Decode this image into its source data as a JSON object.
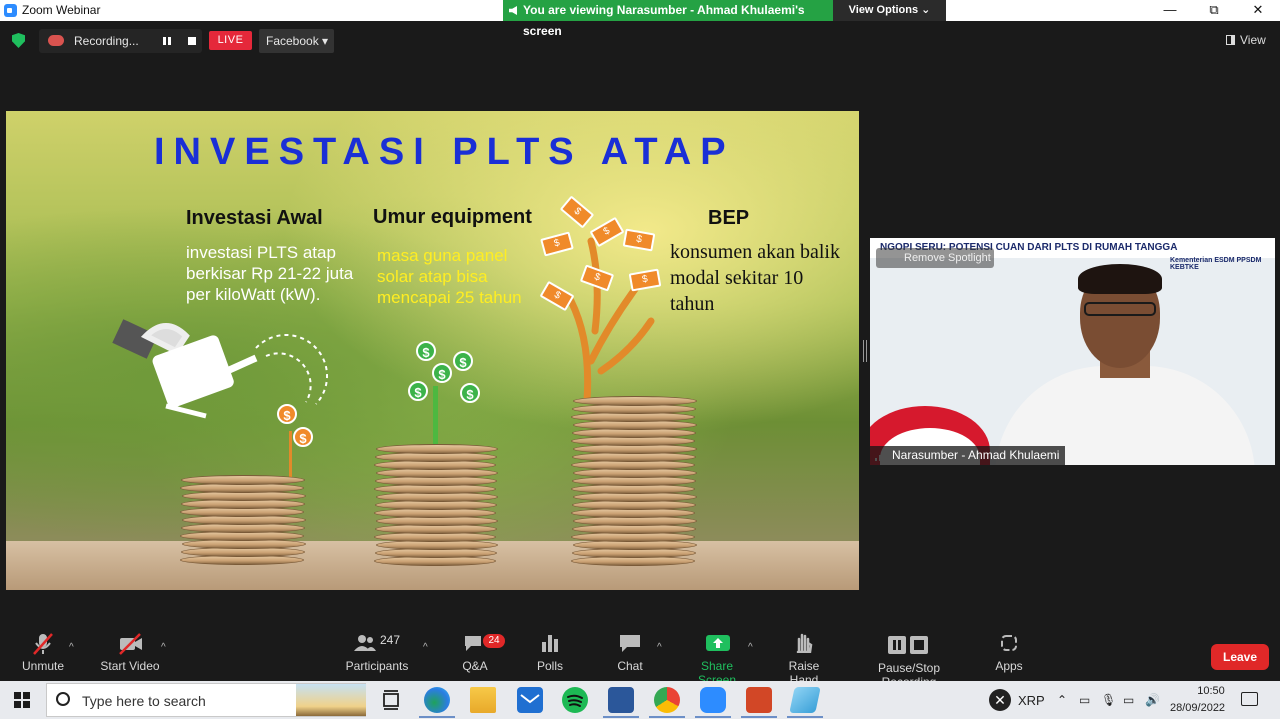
{
  "window": {
    "title": "Zoom Webinar",
    "viewing_banner": "You are viewing Narasumber - Ahmad Khulaemi's screen",
    "view_options": "View Options ⌄",
    "controls": {
      "minimize": "—",
      "restore": "⧉",
      "close": "✕"
    }
  },
  "recording_bar": {
    "status": "Recording...",
    "live_label": "LIVE",
    "stream_target": "Facebook ▾",
    "view_label": "View"
  },
  "slide": {
    "title": "INVESTASI PLTS ATAP",
    "col1": {
      "heading": "Investasi Awal",
      "body": "investasi PLTS atap berkisar Rp 21-22 juta per kiloWatt (kW)."
    },
    "col2": {
      "heading": "Umur equipment",
      "body": "masa guna panel solar atap bisa mencapai 25 tahun"
    },
    "col3": {
      "heading": "BEP",
      "body": "konsumen akan balik modal sekitar 10 tahun"
    },
    "currency_symbol": "$"
  },
  "video": {
    "banner": "NGOPI SERU: POTENSI CUAN DARI PLTS DI RUMAH TANGGA",
    "logo_text": "Kementerian ESDM PPSDM KEBTKE",
    "spotlight": "Remove Spotlight",
    "name": "Narasumber - Ahmad Khulaemi"
  },
  "toolbar": {
    "unmute": "Unmute",
    "start_video": "Start Video",
    "participants": "Participants",
    "participants_count": "247",
    "qa": "Q&A",
    "qa_badge": "24",
    "polls": "Polls",
    "chat": "Chat",
    "share_screen": "Share Screen",
    "raise_hand": "Raise Hand",
    "pause_stop_recording": "Pause/Stop Recording",
    "apps": "Apps",
    "leave": "Leave"
  },
  "taskbar": {
    "search_placeholder": "Type here to search",
    "tray_ticker": "XRP",
    "time": "10:50",
    "date": "28/09/2022"
  },
  "colors": {
    "title_blue": "#1a2fd6",
    "banner_green": "#25a244",
    "live_red": "#e5283a",
    "leave_red": "#e02828",
    "share_green": "#1fbf5e"
  }
}
